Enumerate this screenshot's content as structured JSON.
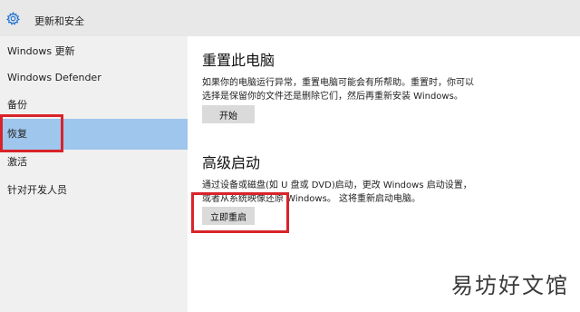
{
  "header": {
    "title": "更新和安全",
    "icon": "gear-icon"
  },
  "sidebar": {
    "items": [
      {
        "label": "Windows 更新",
        "selected": false
      },
      {
        "label": "Windows Defender",
        "selected": false
      },
      {
        "label": "备份",
        "selected": false
      },
      {
        "label": "恢复",
        "selected": true
      },
      {
        "label": "激活",
        "selected": false
      },
      {
        "label": "针对开发人员",
        "selected": false
      }
    ]
  },
  "main": {
    "reset": {
      "title": "重置此电脑",
      "description": "如果你的电脑运行异常，重置电脑可能会有所帮助。重置时，你可以选择是保留你的文件还是删除它们，然后再重新安装 Windows。",
      "button": "开始"
    },
    "advanced": {
      "title": "高级启动",
      "description": "通过设备或磁盘(如 U 盘或 DVD)启动，更改 Windows 启动设置，或者从系统映像还原 Windows。 这将重新启动电脑。",
      "button": "立即重启"
    }
  },
  "watermark": "易坊好文馆",
  "colors": {
    "accent": "#1e6fd0",
    "selected": "#9fc6ec",
    "highlight_box": "#d9232a"
  }
}
